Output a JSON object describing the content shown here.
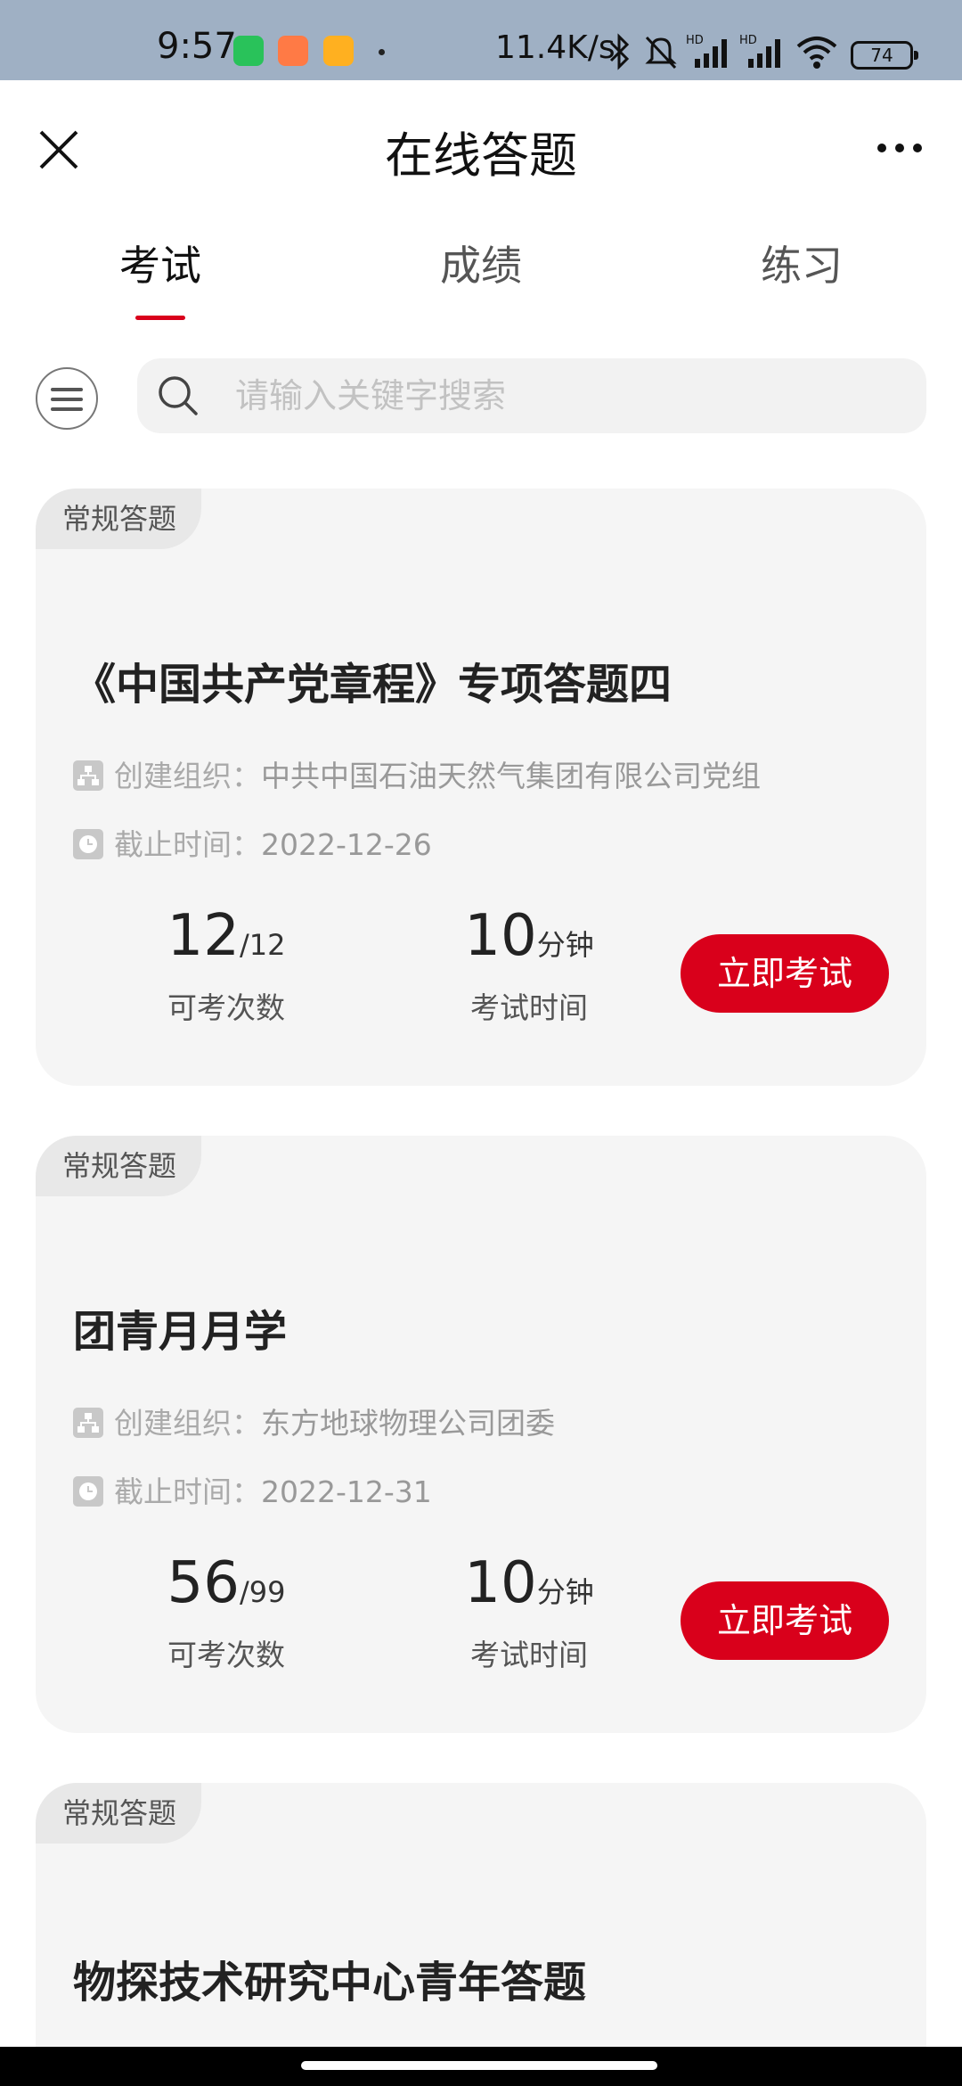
{
  "status_bar": {
    "time": "9:57",
    "network_speed": "11.4K/s",
    "battery": "74",
    "icons": [
      "wechat-icon",
      "shop-app-icon",
      "game-app-icon",
      "bluetooth-icon",
      "mute-bell-icon",
      "hd-signal-icon",
      "hd-signal-icon",
      "wifi-icon",
      "battery-icon"
    ]
  },
  "header": {
    "title": "在线答题",
    "close_icon": "close-icon",
    "more_icon": "more-dots-icon"
  },
  "tabs": [
    {
      "label": "考试",
      "active": true
    },
    {
      "label": "成绩",
      "active": false
    },
    {
      "label": "练习",
      "active": false
    }
  ],
  "search": {
    "placeholder": "请输入关键字搜索",
    "value": ""
  },
  "cards": [
    {
      "tag": "常规答题",
      "title": "《中国共产党章程》专项答题四",
      "org_label": "创建组织：",
      "org": "中共中国石油天然气集团有限公司党组",
      "deadline_label": "截止时间：",
      "deadline": "2022-12-26",
      "attempts": "12",
      "attempts_total": "/12",
      "attempts_caption": "可考次数",
      "duration": "10",
      "duration_unit": "分钟",
      "duration_caption": "考试时间",
      "button": "立即考试"
    },
    {
      "tag": "常规答题",
      "title": "团青月月学",
      "org_label": "创建组织：",
      "org": "东方地球物理公司团委",
      "deadline_label": "截止时间：",
      "deadline": "2022-12-31",
      "attempts": "56",
      "attempts_total": "/99",
      "attempts_caption": "可考次数",
      "duration": "10",
      "duration_unit": "分钟",
      "duration_caption": "考试时间",
      "button": "立即考试"
    },
    {
      "tag": "常规答题",
      "title": "物探技术研究中心青年答题"
    }
  ],
  "colors": {
    "accent": "#d9001b",
    "status_bar": "#9fb0c4",
    "card_bg": "#f5f5f5"
  }
}
